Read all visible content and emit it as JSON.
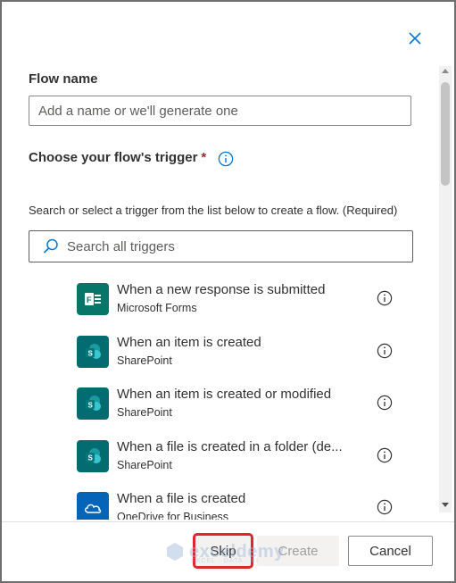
{
  "dialog": {
    "close_icon": "close-icon",
    "flow_name": {
      "label": "Flow name",
      "placeholder": "Add a name or we'll generate one",
      "value": ""
    },
    "trigger": {
      "label": "Choose your flow's trigger",
      "required_mark": "*",
      "info_icon": "info-icon",
      "helper_text": "Search or select a trigger from the list below to create a flow. (Required)"
    },
    "search": {
      "icon": "search-icon",
      "placeholder": "Search all triggers"
    },
    "triggers": [
      {
        "name": "When a new response is submitted",
        "source": "Microsoft Forms",
        "icon": "forms-icon",
        "color": "#077568"
      },
      {
        "name": "When an item is created",
        "source": "SharePoint",
        "icon": "sharepoint-icon",
        "color": "#036c70"
      },
      {
        "name": "When an item is created or modified",
        "source": "SharePoint",
        "icon": "sharepoint-icon",
        "color": "#036c70"
      },
      {
        "name": "When a file is created in a folder (de...",
        "source": "SharePoint",
        "icon": "sharepoint-icon",
        "color": "#036c70"
      },
      {
        "name": "When a file is created",
        "source": "OneDrive for Business",
        "icon": "onedrive-icon",
        "color": "#0364b8"
      }
    ]
  },
  "footer": {
    "skip_label": "Skip",
    "create_label": "Create",
    "cancel_label": "Cancel",
    "watermark_text": "exceldemy",
    "watermark_sub": "EXCEL · DATA · BI"
  },
  "colors": {
    "accent": "#0078d4",
    "highlight": "#e0262c",
    "required": "#a4262c"
  }
}
